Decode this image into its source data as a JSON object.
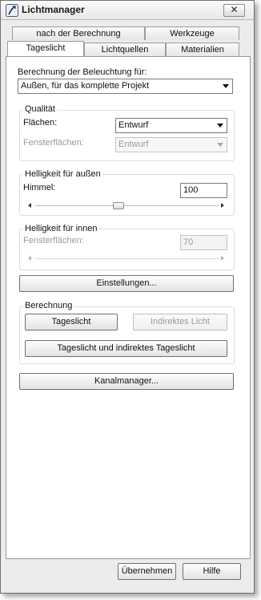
{
  "window": {
    "title": "Lichtmanager",
    "close_symbol": "✕"
  },
  "tabs": {
    "row_back": [
      {
        "label": "nach der Berechnung"
      },
      {
        "label": "Werkzeuge"
      }
    ],
    "row_front": [
      {
        "label": "Tageslicht",
        "active": true
      },
      {
        "label": "Lichtquellen"
      },
      {
        "label": "Materialien"
      }
    ]
  },
  "calc_for": {
    "label": "Berechnung der Beleuchtung für:",
    "value": "Außen, für das komplette Projekt"
  },
  "quality": {
    "title": "Qualität",
    "faces_label": "Flächen:",
    "faces_value": "Entwurf",
    "windows_label": "Fensterflächen:",
    "windows_value": "Entwurf"
  },
  "brightness_outside": {
    "title": "Helligkeit für außen",
    "sky_label": "Himmel:",
    "sky_value": "100",
    "slider_fraction": 0.45
  },
  "brightness_inside": {
    "title": "Helligkeit für innen",
    "windows_label": "Fensterflächen:",
    "windows_value": "70"
  },
  "settings_button": "Einstellungen...",
  "calculation": {
    "title": "Berechnung",
    "daylight_button": "Tageslicht",
    "indirect_button": "Indirektes Licht",
    "both_button": "Tageslicht und indirektes Tageslicht"
  },
  "channel_manager_button": "Kanalmanager...",
  "footer": {
    "apply_button": "Übernehmen",
    "help_button": "Hilfe"
  },
  "icons": {
    "app": "lightmanager-app-icon",
    "close": "close-icon",
    "dropdown": "chevron-down-icon"
  },
  "colors": {
    "panel": "#ffffff",
    "window_bg": "#ececec",
    "close_hover_accent": "#c94c3c"
  }
}
